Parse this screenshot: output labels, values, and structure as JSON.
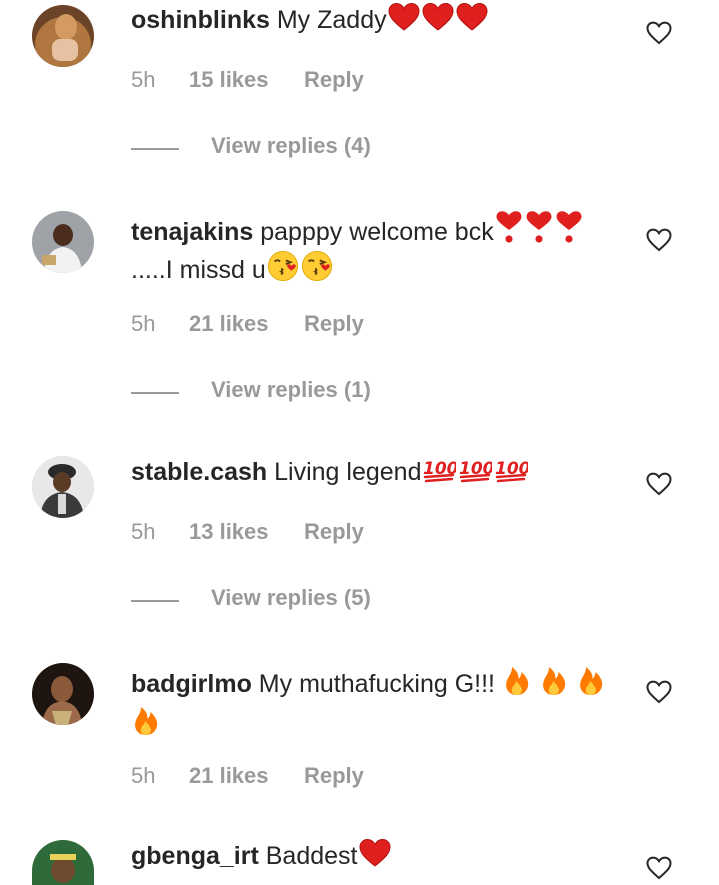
{
  "comments": [
    {
      "username": "oshinblinks",
      "text": "My Zaddy",
      "time": "5h",
      "likes": "15 likes",
      "reply": "Reply",
      "view_replies": "View replies (4)"
    },
    {
      "username": "tenajakins",
      "text": "papppy welcome bck",
      "text2": ".....I missd u",
      "time": "5h",
      "likes": "21 likes",
      "reply": "Reply",
      "view_replies": "View replies (1)"
    },
    {
      "username": "stable.cash",
      "text": "Living legend",
      "time": "5h",
      "likes": "13 likes",
      "reply": "Reply",
      "view_replies": "View replies (5)"
    },
    {
      "username": "badgirlmo",
      "text": "My muthafucking G!!!",
      "time": "5h",
      "likes": "21 likes",
      "reply": "Reply"
    },
    {
      "username": "gbenga_irt",
      "text": "Baddest"
    }
  ],
  "icons": {
    "like": "heart-outline-icon",
    "red_heart": "red-heart-emoji",
    "heavy_heart": "heavy-heart-exclamation-emoji",
    "kiss_face": "face-blowing-kiss-emoji",
    "hundred": "hundred-points-emoji",
    "fire": "fire-emoji"
  },
  "colors": {
    "text": "#262626",
    "secondary": "#999999",
    "heart_emoji": "#e0201f",
    "fire": "#ff7a00"
  }
}
